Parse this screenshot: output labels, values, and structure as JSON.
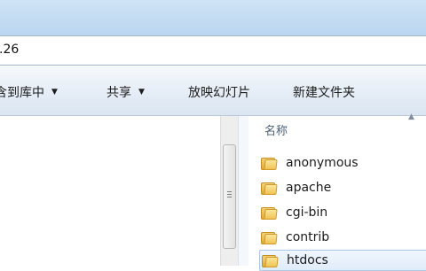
{
  "address": {
    "text": ".26"
  },
  "toolbar": {
    "items": [
      {
        "label": "含到库中",
        "has_dropdown": true
      },
      {
        "label": "共享",
        "has_dropdown": true
      },
      {
        "label": "放映幻灯片",
        "has_dropdown": false
      },
      {
        "label": "新建文件夹",
        "has_dropdown": false
      }
    ],
    "dropdown_glyph": "▼"
  },
  "file_list": {
    "column_header": "名称",
    "sort_glyph": "▲",
    "items": [
      {
        "name": "anonymous",
        "icon": "folder-icon"
      },
      {
        "name": "apache",
        "icon": "folder-icon"
      },
      {
        "name": "cgi-bin",
        "icon": "folder-icon"
      },
      {
        "name": "contrib",
        "icon": "folder-icon"
      },
      {
        "name": "htdocs",
        "icon": "folder-icon"
      }
    ]
  },
  "colors": {
    "toolbar_bg": "#e4ecf6",
    "folder": "#efc457",
    "selection": "#e0ecfa"
  }
}
